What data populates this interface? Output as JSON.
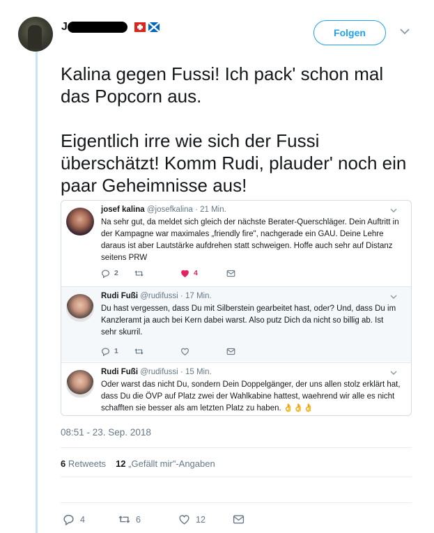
{
  "author": {
    "initial": "J",
    "flags": [
      "swiss-flag-icon",
      "scottish-flag-icon"
    ],
    "follow_label": "Folgen"
  },
  "tweet": {
    "paragraph1": "Kalina gegen Fussi! Ich pack' schon mal das Popcorn aus.",
    "paragraph2": "Eigentlich irre wie sich der Fussi überschätzt! Komm Rudi, plauder' noch ein paar Geheimnisse aus!"
  },
  "quoted_thread": [
    {
      "name": "josef kalina",
      "handle": "@josefkalina",
      "dot": "·",
      "time": "21 Min.",
      "text": "Na sehr gut, da meldet sich gleich der nächste Berater-Querschläger. Dein Auftritt in der Kampagne war maximales „friendly fire\", nachgerade ein GAU. Deine Lehre daraus ist aber Lautstärke aufdrehen statt schweigen. Hoffe auch sehr auf Distanz seitens PRW",
      "replies": "2",
      "retweets": "",
      "likes": "4",
      "liked": true
    },
    {
      "name": "Rudi Fußi",
      "handle": "@rudifussi",
      "dot": "·",
      "time": "17 Min.",
      "text": "Du hast vergessen, dass Du mit Silberstein gearbeitet hast, oder? Und, dass Du im Kanzleramt ja auch bei Kern dabei warst. Also putz Dich da nicht so billig ab. Ist sehr skurril.",
      "replies": "1",
      "retweets": "",
      "likes": "",
      "liked": false
    },
    {
      "name": "Rudi Fußi",
      "handle": "@rudifussi",
      "dot": "·",
      "time": "15 Min.",
      "text": "Oder warst das nicht Du, sondern Dein Doppelgänger, der uns allen stolz erklärt hat, dass Du die ÖVP auf Platz zwei der Wahlkabine hattest, waehrend wir alle es nicht schafften sie besser als am letzten Platz zu haben. 👌👌👌"
    }
  ],
  "timestamp": "08:51 - 23. Sep. 2018",
  "stats": {
    "retweets_count": "6",
    "retweets_label": "Retweets",
    "likes_count": "12",
    "likes_label": "„Gefällt mir\"-Angaben"
  },
  "actions": {
    "replies": "4",
    "retweets": "6",
    "likes": "12"
  },
  "colors": {
    "accent": "#1da1f2",
    "like_red": "#e0245e",
    "muted": "#657786",
    "thread_line": "#c4e5f7"
  }
}
